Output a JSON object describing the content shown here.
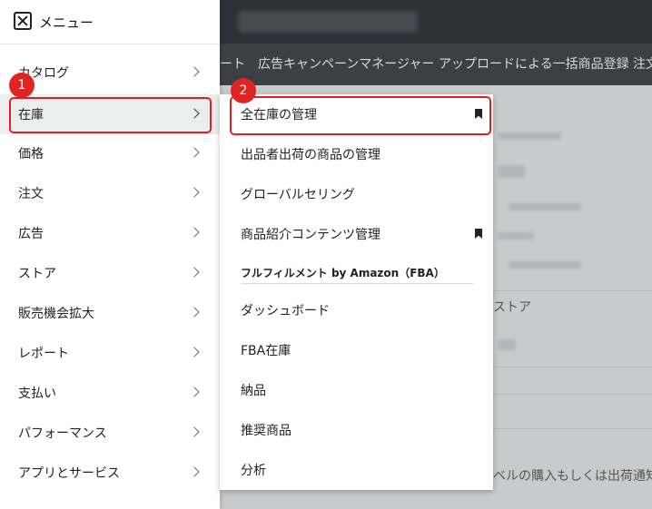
{
  "menu": {
    "title": "メニュー",
    "items": [
      {
        "label": "カタログ"
      },
      {
        "label": "在庫"
      },
      {
        "label": "価格"
      },
      {
        "label": "注文"
      },
      {
        "label": "広告"
      },
      {
        "label": "ストア"
      },
      {
        "label": "販売機会拡大"
      },
      {
        "label": "レポート"
      },
      {
        "label": "支払い"
      },
      {
        "label": "パフォーマンス"
      },
      {
        "label": "アプリとサービス"
      }
    ]
  },
  "submenu": {
    "items": [
      {
        "label": "全在庫の管理"
      },
      {
        "label": "出品者出荷の商品の管理"
      },
      {
        "label": "グローバルセリング"
      },
      {
        "label": "商品紹介コンテンツ管理"
      }
    ],
    "section_title": "フルフィルメント by Amazon（FBA）",
    "fba_items": [
      {
        "label": "ダッシュボード"
      },
      {
        "label": "FBA在庫"
      },
      {
        "label": "納品"
      },
      {
        "label": "推奨商品"
      },
      {
        "label": "分析"
      }
    ]
  },
  "nav": {
    "items": [
      {
        "label": "ート"
      },
      {
        "label": "広告キャンペーンマネージャー"
      },
      {
        "label": "アップロードによる一括商品登録"
      },
      {
        "label": "注文"
      }
    ]
  },
  "background": {
    "store_text": "ストア",
    "bottom_text": "ベルの購入もしくは出荷通知"
  },
  "annotations": {
    "step1": "1",
    "step2": "2"
  },
  "colors": {
    "highlight": "#e02020",
    "header_bg": "#2b3136",
    "nav_bg": "#3a4046"
  },
  "icons": {
    "close": "close-icon",
    "chevron": "chevron-right-icon",
    "bookmark": "bookmark-icon"
  }
}
